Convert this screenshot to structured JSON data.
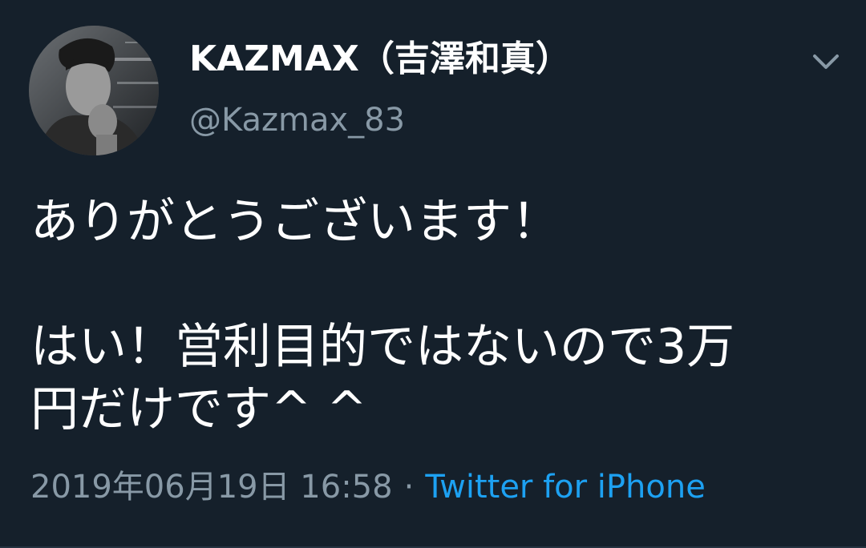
{
  "tweet": {
    "author": {
      "display_name": "KAZMAX（吉澤和真）",
      "handle": "@Kazmax_83",
      "avatar_icon": "profile-photo"
    },
    "menu_icon": "chevron-down-icon",
    "text": "ありがとうございます！\n\nはい！営利目的ではないので3万\n円だけです^ ^",
    "timestamp": "2019年06月19日 16:58",
    "separator": "·",
    "source": "Twitter for iPhone"
  },
  "colors": {
    "background": "#15202b",
    "primary_text": "#ffffff",
    "secondary_text": "#8899a6",
    "link": "#1da1f2"
  }
}
